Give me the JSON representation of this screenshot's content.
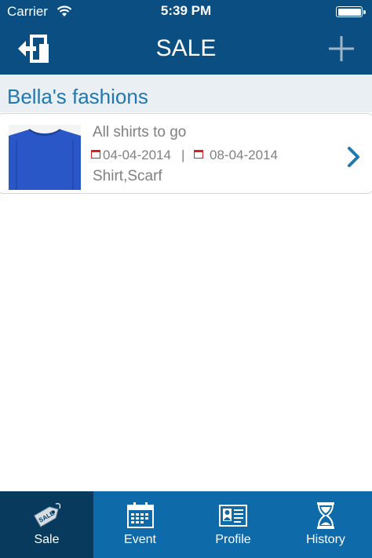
{
  "status_bar": {
    "carrier": "Carrier",
    "time": "5:39 PM"
  },
  "nav": {
    "title": "SALE"
  },
  "section": {
    "title": "Bella's fashions"
  },
  "sale": {
    "title": "All shirts to go",
    "start_date": "04-04-2014",
    "separator": "|",
    "end_date": "08-04-2014",
    "items": "Shirt,Scarf"
  },
  "tabs": [
    {
      "label": "Sale",
      "icon": "sale-tag-icon",
      "active": true
    },
    {
      "label": "Event",
      "icon": "calendar-icon",
      "active": false
    },
    {
      "label": "Profile",
      "icon": "profile-card-icon",
      "active": false
    },
    {
      "label": "History",
      "icon": "hourglass-icon",
      "active": false
    }
  ],
  "colors": {
    "nav_bg": "#0b4f82",
    "tabbar_bg": "#0e6aa8",
    "tab_active_bg": "#073a5d",
    "accent": "#1f78b0",
    "date_icon": "#e11d1d"
  }
}
